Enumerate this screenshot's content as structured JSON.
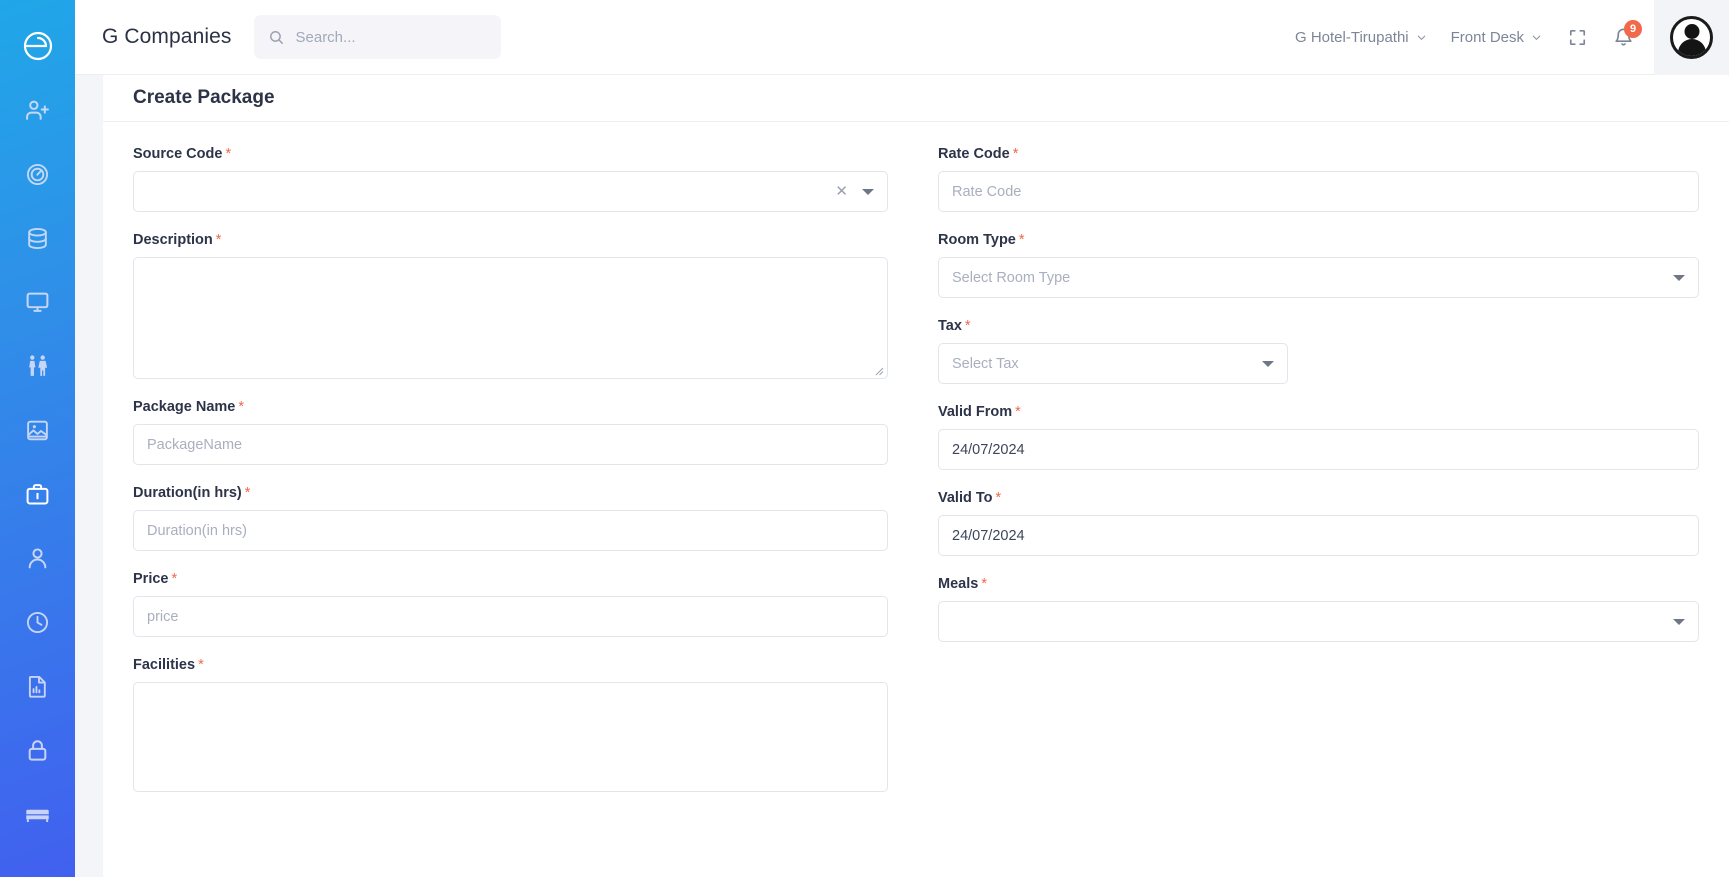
{
  "brand": {
    "title": "G Companies",
    "logo_icon": "circle-e-logo-icon"
  },
  "search": {
    "placeholder": "Search...",
    "icon": "search-icon"
  },
  "header": {
    "property_selector": {
      "label": "G Hotel-Tirupathi",
      "caret_icon": "chevron-down-icon"
    },
    "module_selector": {
      "label": "Front Desk",
      "caret_icon": "chevron-down-icon"
    },
    "fullscreen_icon": "expand-fullscreen-icon",
    "notifications": {
      "icon": "bell-icon",
      "count": "9",
      "badge_color": "#f2684a"
    },
    "avatar_icon": "user-avatar-icon"
  },
  "sidebar": {
    "background_gradient": [
      "#20a7e8",
      "#4160ef"
    ],
    "items": [
      {
        "name": "add-user",
        "icon": "user-plus-icon",
        "active": false
      },
      {
        "name": "dashboard",
        "icon": "speedometer-icon",
        "active": false
      },
      {
        "name": "database",
        "icon": "database-icon",
        "active": false
      },
      {
        "name": "desktop",
        "icon": "monitor-icon",
        "active": false
      },
      {
        "name": "housekeeping",
        "icon": "restroom-people-icon",
        "active": false
      },
      {
        "name": "gallery",
        "icon": "image-card-icon",
        "active": false
      },
      {
        "name": "packages",
        "icon": "briefcase-icon",
        "active": true
      },
      {
        "name": "profile",
        "icon": "person-icon",
        "active": false
      },
      {
        "name": "shifts",
        "icon": "clock-icon",
        "active": false
      },
      {
        "name": "reports",
        "icon": "report-chart-file-icon",
        "active": false
      },
      {
        "name": "security",
        "icon": "lock-icon",
        "active": false
      },
      {
        "name": "rooms",
        "icon": "bed-icon",
        "active": false
      }
    ]
  },
  "page": {
    "title": "Create Package",
    "required_marker": "*",
    "left_fields": [
      {
        "key": "source_code",
        "label": "Source Code",
        "required": true,
        "type": "select-clearable",
        "value": "",
        "placeholder": "",
        "clear_icon": "close-x-icon",
        "caret_icon": "dropdown-triangle-icon"
      },
      {
        "key": "description",
        "label": "Description",
        "required": true,
        "type": "textarea",
        "value": "",
        "placeholder": ""
      },
      {
        "key": "package_name",
        "label": "Package Name",
        "required": true,
        "type": "text",
        "value": "",
        "placeholder": "PackageName"
      },
      {
        "key": "duration",
        "label": "Duration(in hrs)",
        "required": true,
        "type": "text",
        "value": "",
        "placeholder": "Duration(in hrs)"
      },
      {
        "key": "price",
        "label": "Price",
        "required": true,
        "type": "text",
        "value": "",
        "placeholder": "price"
      },
      {
        "key": "facilities",
        "label": "Facilities",
        "required": true,
        "type": "textarea",
        "value": "",
        "placeholder": ""
      }
    ],
    "right_fields": [
      {
        "key": "rate_code",
        "label": "Rate Code",
        "required": true,
        "type": "text",
        "value": "",
        "placeholder": "Rate Code"
      },
      {
        "key": "room_type",
        "label": "Room Type",
        "required": true,
        "type": "select",
        "value": "",
        "placeholder": "Select Room Type",
        "caret_icon": "dropdown-triangle-icon"
      },
      {
        "key": "tax",
        "label": "Tax",
        "required": true,
        "type": "select-narrow",
        "value": "",
        "placeholder": "Select Tax",
        "caret_icon": "dropdown-triangle-icon"
      },
      {
        "key": "valid_from",
        "label": "Valid From",
        "required": true,
        "type": "date",
        "value": "24/07/2024",
        "placeholder": ""
      },
      {
        "key": "valid_to",
        "label": "Valid To",
        "required": true,
        "type": "date",
        "value": "24/07/2024",
        "placeholder": ""
      },
      {
        "key": "meals",
        "label": "Meals",
        "required": true,
        "type": "select",
        "value": "",
        "placeholder": "",
        "caret_icon": "dropdown-triangle-icon"
      }
    ]
  }
}
